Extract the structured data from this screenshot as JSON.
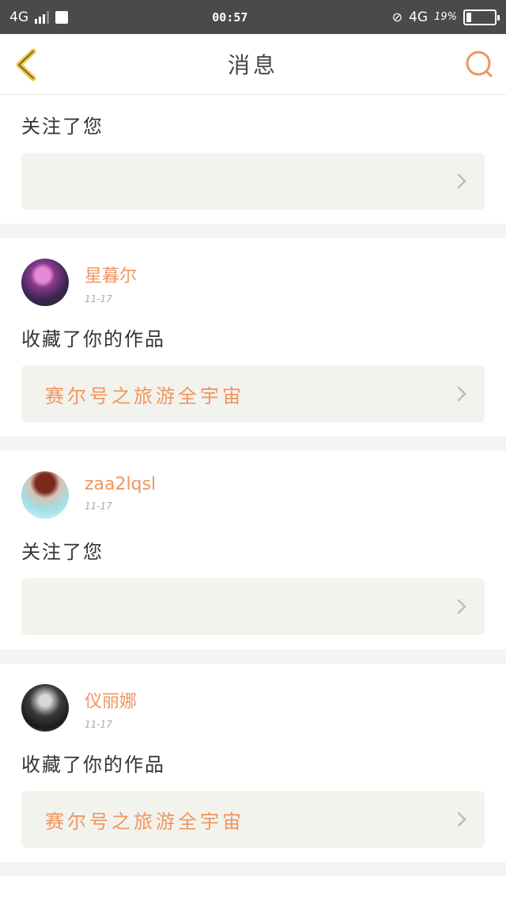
{
  "status_bar": {
    "network_left": "4G",
    "time": "00:57",
    "network_right": "4G",
    "battery": "19%"
  },
  "nav": {
    "title": "消息"
  },
  "notifications": [
    {
      "action": "关注了您",
      "has_user": false
    },
    {
      "username": "星暮尔",
      "date": "11-17",
      "action": "收藏了你的作品",
      "work_title": "赛尔号之旅游全宇宙"
    },
    {
      "username": "zaa2lqsl",
      "date": "11-17",
      "action": "关注了您"
    },
    {
      "username": "仪丽娜",
      "date": "11-17",
      "action": "收藏了你的作品",
      "work_title": "赛尔号之旅游全宇宙"
    }
  ],
  "colors": {
    "accent": "#f0955f",
    "status_bar_bg": "#4a4a4a",
    "back_icon": "#e9c64a",
    "box_bg": "#f3f3ee"
  }
}
